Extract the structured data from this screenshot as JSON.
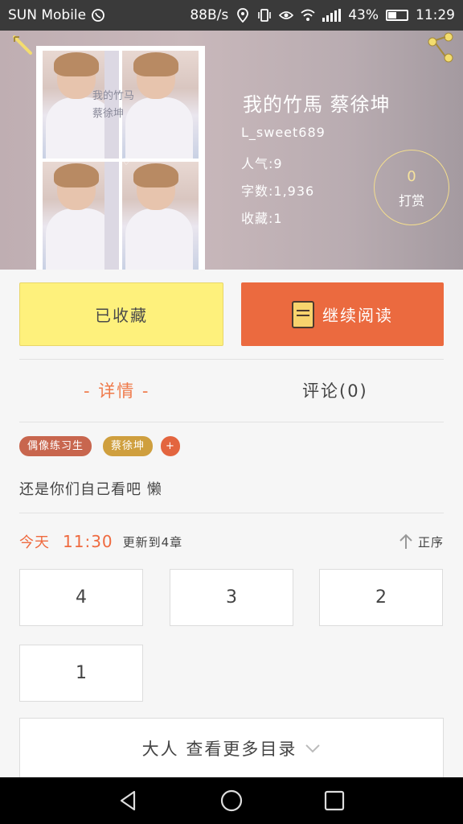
{
  "status_bar": {
    "carrier": "SUN Mobile",
    "speed": "88B/s",
    "battery": "43%",
    "time": "11:29"
  },
  "header": {
    "cover_text": [
      "我的竹马",
      "蔡徐坤"
    ],
    "title": "我的竹馬 蔡徐坤",
    "author": "L_sweet689",
    "popularity": "人气:9",
    "word_count": "字数:1,936",
    "favorites": "收藏:1",
    "reward_count": "0",
    "reward_label": "打赏"
  },
  "actions": {
    "favorite_label": "已收藏",
    "read_label": "继续阅读"
  },
  "tabs": {
    "detail": "- 详情 -",
    "comments": "评论(0)"
  },
  "tags": [
    "偶像练习生",
    "蔡徐坤",
    "+"
  ],
  "summary": "还是你们自己看吧 懒",
  "update": {
    "date": "今天",
    "time": "11:30",
    "text": "更新到4章",
    "sort_label": "正序"
  },
  "chapters": [
    "4",
    "3",
    "2",
    "1"
  ],
  "more_label": "大人 查看更多目录",
  "colors": {
    "accent": "#eb6a3f",
    "favorite_bg": "#fef17c",
    "tag_red": "#c8664e",
    "tag_gold": "#cf9f3e"
  },
  "icons": {
    "back": "pencil-back-icon",
    "share": "share-icon",
    "book": "book-icon",
    "sort": "arrow-up-icon",
    "more": "chevron-down-icon"
  }
}
